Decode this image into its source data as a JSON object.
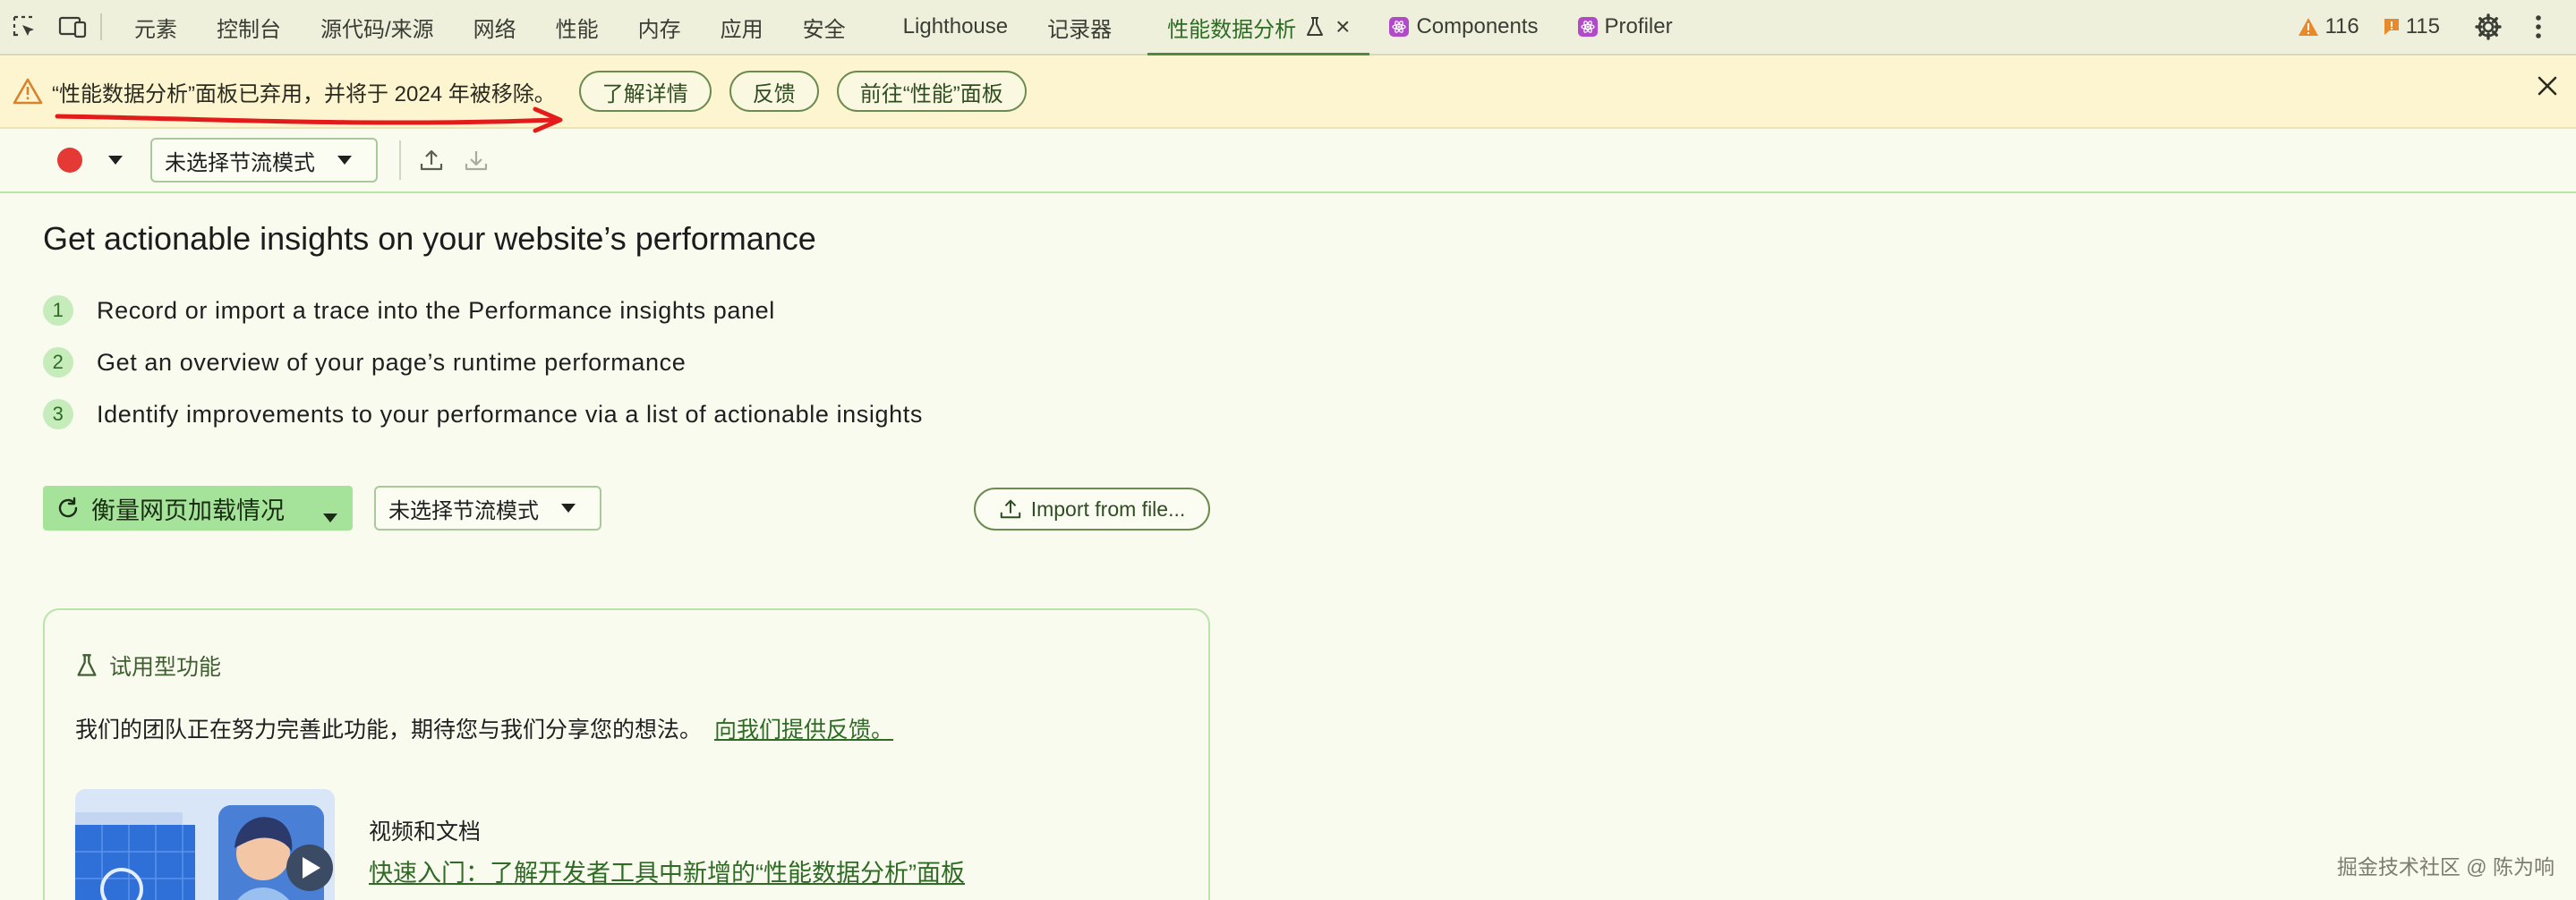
{
  "tabbar": {
    "tabs": [
      {
        "label": "元素"
      },
      {
        "label": "控制台"
      },
      {
        "label": "源代码/来源"
      },
      {
        "label": "网络"
      },
      {
        "label": "性能"
      },
      {
        "label": "内存"
      },
      {
        "label": "应用"
      },
      {
        "label": "安全"
      },
      {
        "label": "Lighthouse"
      },
      {
        "label": "记录器"
      },
      {
        "label": "性能数据分析"
      },
      {
        "label": "Components"
      },
      {
        "label": "Profiler"
      }
    ],
    "warnings_count": "116",
    "issues_count": "115",
    "icons": [
      "inspect-element-icon",
      "device-toolbar-icon",
      "flask-icon",
      "close-icon",
      "react-icon",
      "warning-icon",
      "issue-icon",
      "gear-icon",
      "more-icon"
    ]
  },
  "banner": {
    "message": "“性能数据分析”面板已弃用，并将于 2024 年被移除。",
    "learn_more": "了解详情",
    "feedback": "反馈",
    "goto_performance": "前往“性能”面板",
    "accent": "#e8a33d",
    "annotation_color": "#e31b1b"
  },
  "toolbar": {
    "throttle": "未选择节流模式",
    "record_color": "#e53935"
  },
  "main": {
    "title": "Get actionable insights on your website’s performance",
    "steps": [
      {
        "num": "1",
        "text": "Record or import a trace into the Performance insights panel"
      },
      {
        "num": "2",
        "text": "Get an overview of your page’s runtime performance"
      },
      {
        "num": "3",
        "text": "Identify improvements to your performance via a list of actionable insights"
      }
    ],
    "measure_button": "衡量网页加载情况",
    "throttle": "未选择节流模式",
    "import_button": "Import from file..."
  },
  "card": {
    "heading": "试用型功能",
    "description": "我们的团队正在努力完善此功能，期待您与我们分享您的想法。",
    "feedback_link": "向我们提供反馈。",
    "video_label": "视频和文档",
    "video_link": "快速入门：了解开发者工具中新增的“性能数据分析”面板"
  },
  "watermark": "掘金技术社区 @ 陈为响"
}
